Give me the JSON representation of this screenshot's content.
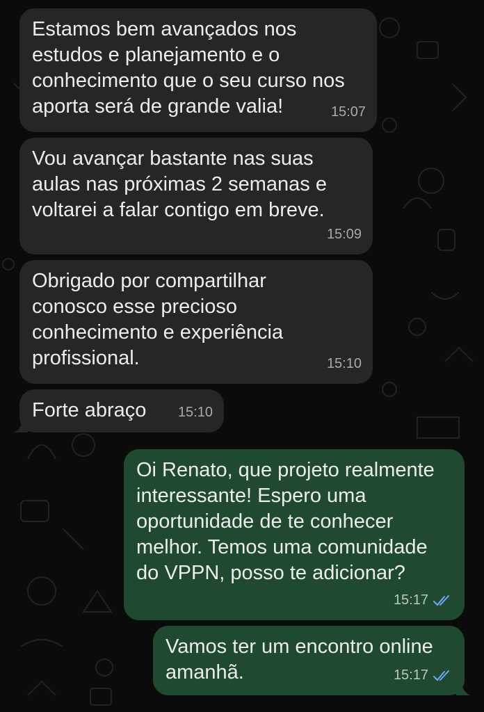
{
  "colors": {
    "background": "#0b0b0b",
    "incoming_bubble": "#262626",
    "outgoing_bubble": "#1f4a2f",
    "text": "#ececec",
    "read_ticks": "#6aa8ff"
  },
  "messages": [
    {
      "direction": "in",
      "text": "Estamos bem avançados nos\nestudos e planejamento e o\nconhecimento que o seu curso nos\naporta será de grande valia!",
      "time": "15:07"
    },
    {
      "direction": "in",
      "text": "Vou avançar bastante nas suas\naulas nas próximas 2 semanas e\nvoltarei a falar contigo em breve.",
      "time": "15:09"
    },
    {
      "direction": "in",
      "text": "Obrigado por compartilhar\nconosco esse precioso\nconhecimento e experiência\nprofissional.",
      "time": "15:10"
    },
    {
      "direction": "in",
      "text": "Forte abraço",
      "time": "15:10"
    },
    {
      "direction": "out",
      "text": "Oi Renato, que projeto realmente\ninteressante! Espero uma\noportunidade de te conhecer\nmelhor. Temos uma comunidade\ndo VPPN, posso te adicionar?",
      "time": "15:17",
      "status_icon": "double-check-read-icon"
    },
    {
      "direction": "out",
      "text": "Vamos ter um encontro online\namanhã.",
      "time": "15:17",
      "status_icon": "double-check-read-icon"
    }
  ]
}
